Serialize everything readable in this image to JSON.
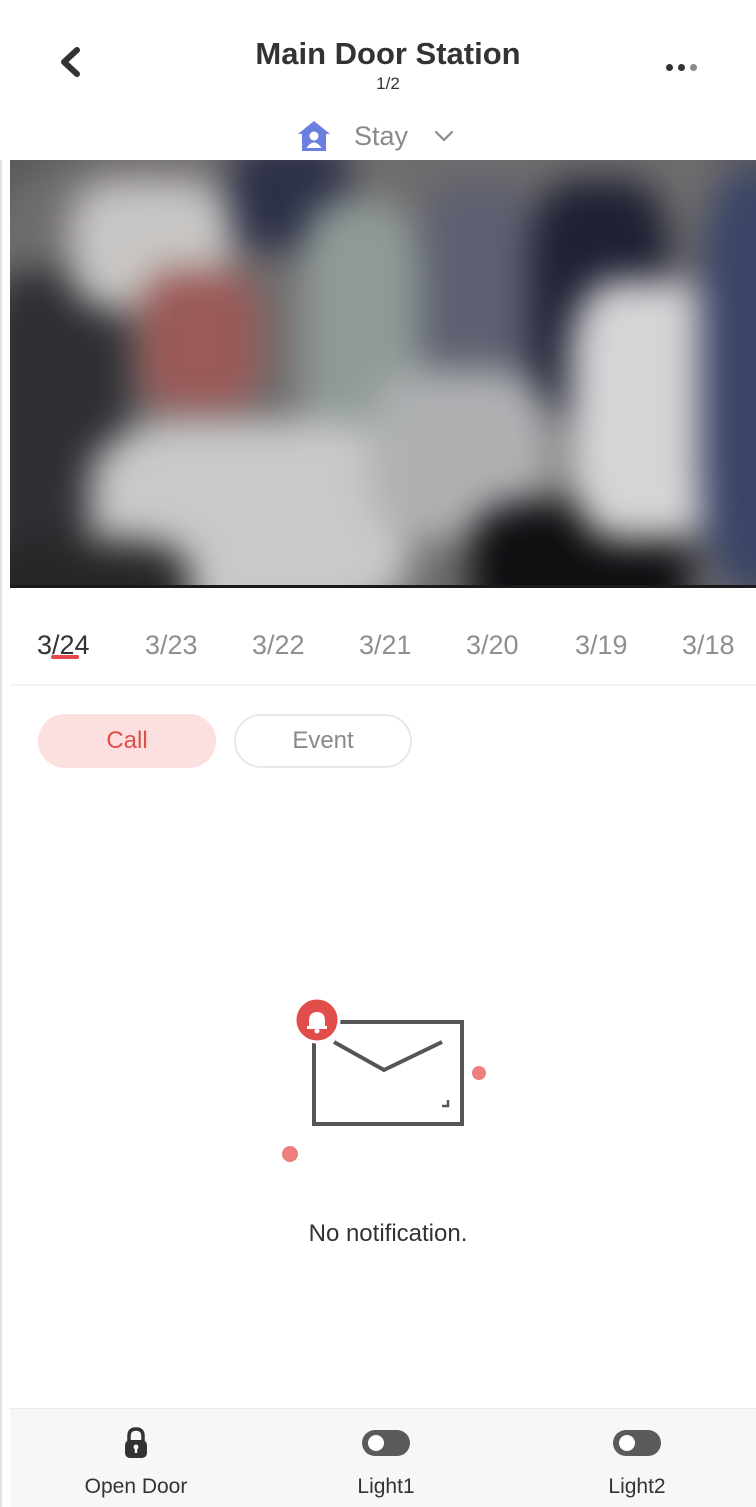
{
  "header": {
    "title": "Main Door Station",
    "subtitle": "1/2",
    "mode": {
      "label": "Stay",
      "icon": "home-user-icon",
      "chevron_icon": "chevron-down-icon"
    },
    "back_icon": "chevron-left-icon",
    "more_icon": "more-dots-icon"
  },
  "video": {
    "description_icon": "live-video-feed"
  },
  "date_tabs": [
    {
      "label": "3/24",
      "active": true
    },
    {
      "label": "3/23",
      "active": false
    },
    {
      "label": "3/22",
      "active": false
    },
    {
      "label": "3/21",
      "active": false
    },
    {
      "label": "3/20",
      "active": false
    },
    {
      "label": "3/19",
      "active": false
    },
    {
      "label": "3/18",
      "active": false
    }
  ],
  "filters": {
    "call_label": "Call",
    "event_label": "Event",
    "selected": "Call"
  },
  "empty_state": {
    "text": "No notification.",
    "icon": "envelope-bell-icon"
  },
  "bottom_bar": {
    "items": [
      {
        "label": "Open Door",
        "icon": "lock-icon"
      },
      {
        "label": "Light1",
        "icon": "toggle-icon"
      },
      {
        "label": "Light2",
        "icon": "toggle-icon"
      }
    ]
  },
  "colors": {
    "accent": "#e64848",
    "chip_selected_bg": "#fbe0df",
    "text_primary": "#333333",
    "text_secondary": "#8f8f8f",
    "mode_icon": "#6b7fe0"
  }
}
